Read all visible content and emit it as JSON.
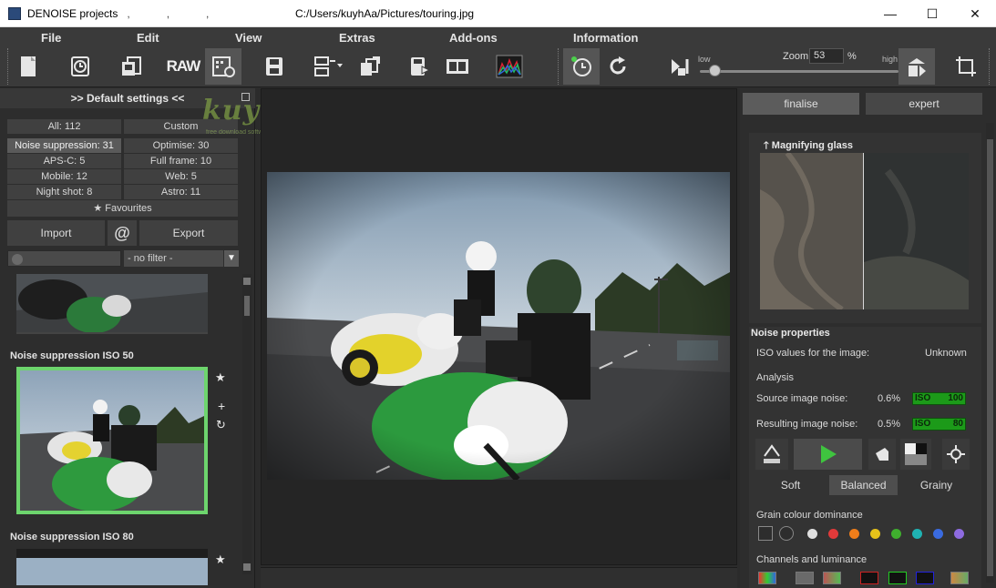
{
  "window": {
    "app_title": "DENOISE projects",
    "title_marks": ",            ,            ,",
    "file_path": "C:/Users/kuyhAa/Pictures/touring.jpg",
    "minimize": "—",
    "maximize": "☐",
    "close": "✕"
  },
  "menu": [
    "File",
    "Edit",
    "View",
    "Extras",
    "Add-ons",
    "Information"
  ],
  "toolbar": {
    "raw_label": "RAW",
    "zoom": {
      "low_label": "low",
      "high_label": "high",
      "label": "Zoom",
      "value": "53",
      "unit": "%",
      "slider_level": 0.05
    }
  },
  "left_panel": {
    "header": ">> Default settings <<",
    "filters": {
      "all": "All: 112",
      "custom": "Custom",
      "noise_suppression": "Noise suppression: 31",
      "optimise": "Optimise: 30",
      "aps_c": "APS-C: 5",
      "full_frame": "Full frame: 10",
      "mobile": "Mobile: 12",
      "web": "Web: 5",
      "night_shot": "Night shot: 8",
      "astro": "Astro: 11",
      "favourites": "Favourites"
    },
    "import_label": "Import",
    "at_label": "@",
    "export_label": "Export",
    "filter_select": "- no filter -",
    "presets": [
      {
        "title": "Noise suppression ISO 50"
      },
      {
        "title": "Noise suppression ISO 80"
      }
    ]
  },
  "watermark": {
    "text": "kuyhAa.Me",
    "sub": "free download software gratis"
  },
  "right_panel": {
    "tabs": [
      "finalise",
      "expert"
    ],
    "magnifier_title": "Magnifying glass",
    "noise_properties": {
      "title": "Noise properties",
      "iso_label": "ISO values for the image:",
      "iso_value": "Unknown",
      "analysis_label": "Analysis",
      "source_label": "Source image noise:",
      "source_value": "0.6%",
      "source_iso_tag": "ISO",
      "source_iso_value": "100",
      "result_label": "Resulting image noise:",
      "result_value": "0.5%",
      "result_iso_tag": "ISO",
      "result_iso_value": "80"
    },
    "grain_modes": [
      "Soft",
      "Balanced",
      "Grainy"
    ],
    "grain_colour_label": "Grain colour dominance",
    "grain_colours": [
      "#e0e0e0",
      "#e23a3a",
      "#ef7d1a",
      "#e6c21a",
      "#3fae2e",
      "#1fb3b3",
      "#3a6be0",
      "#8e6be0"
    ],
    "channels_label": "Channels and luminance"
  }
}
